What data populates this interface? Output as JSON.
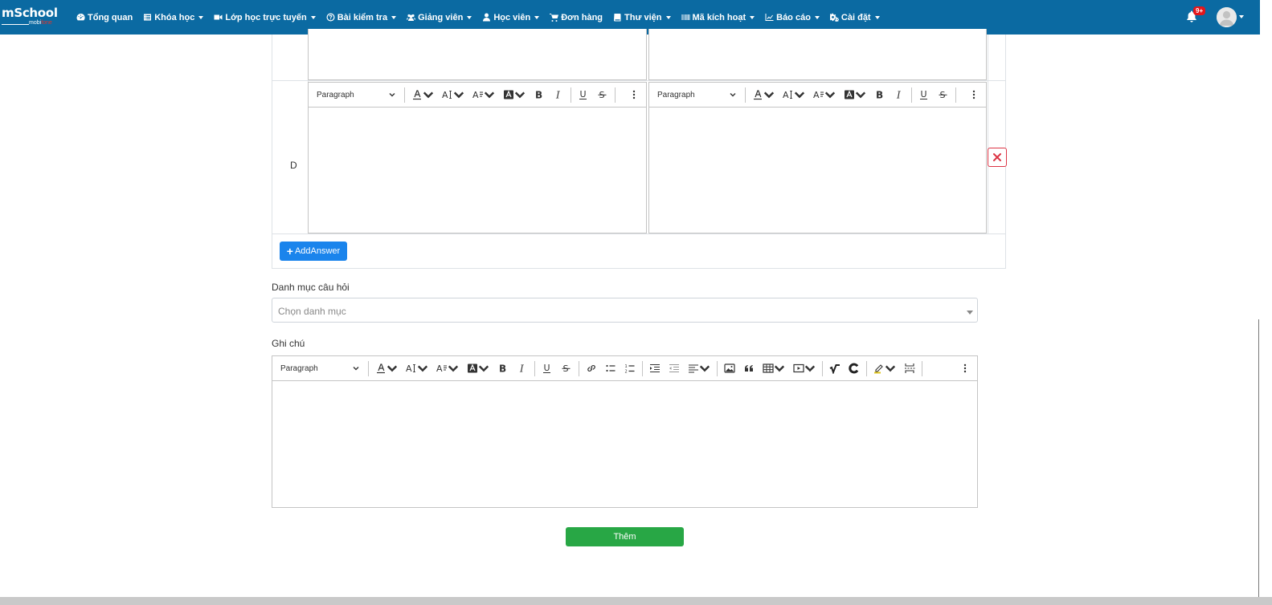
{
  "logo": {
    "main": "mSchool",
    "sub_prefix": "mobi",
    "sub_suffix": "fone"
  },
  "nav": {
    "items": [
      {
        "label": "Tổng quan",
        "icon": "dashboard-icon",
        "caret": false
      },
      {
        "label": "Khóa học",
        "icon": "list-icon",
        "caret": true
      },
      {
        "label": "Lớp học trực tuyến",
        "icon": "video-icon",
        "caret": true
      },
      {
        "label": "Bài kiểm tra",
        "icon": "question-circle-icon",
        "caret": true
      },
      {
        "label": "Giảng viên",
        "icon": "users-icon",
        "caret": true
      },
      {
        "label": "Học viên",
        "icon": "user-icon",
        "caret": true
      },
      {
        "label": "Đơn hàng",
        "icon": "cart-icon",
        "caret": false
      },
      {
        "label": "Thư viện",
        "icon": "book-icon",
        "caret": true
      },
      {
        "label": "Mã kích hoạt",
        "icon": "barcode-icon",
        "caret": true
      },
      {
        "label": "Báo cáo",
        "icon": "chart-icon",
        "caret": true
      },
      {
        "label": "Cài đặt",
        "icon": "cogs-icon",
        "caret": true
      }
    ],
    "notification_badge": "9+"
  },
  "answers": {
    "row_label": "D",
    "add_label": "AddAnswer"
  },
  "editor": {
    "paragraph_label": "Paragraph"
  },
  "category": {
    "label": "Danh mục câu hỏi",
    "placeholder": "Chọn danh mục"
  },
  "note": {
    "label": "Ghi chú"
  },
  "submit_label": "Thêm",
  "colors": {
    "navbar": "#0b6aa2",
    "primary": "#1a84ec",
    "success": "#28a745",
    "danger": "#dc3545"
  }
}
